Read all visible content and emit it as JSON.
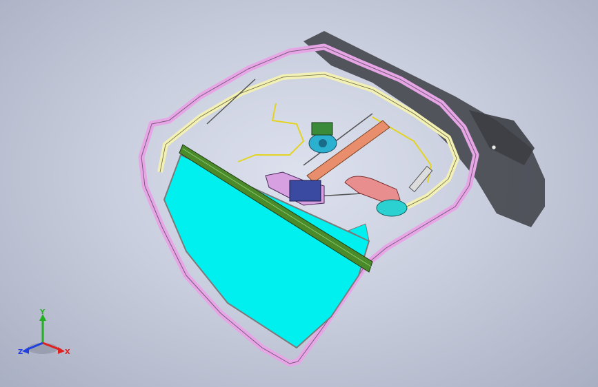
{
  "viewport": {
    "background_center": "#dde1ee",
    "background_edge": "#a9afc2"
  },
  "colors": {
    "outer_frame": "#e6a6e6",
    "inner_seal": "#f2f0b4",
    "glass": "#00f0f0",
    "glass_edge": "#7a7a7a",
    "channel": "#4a8a2a",
    "rail": "#e88e6c",
    "shadow": "#3c3e44",
    "motor": "#2bb0d0",
    "actuator": "#3a4aa0",
    "handle": "#d9a8a8",
    "cable": "#e2d420"
  },
  "triad": {
    "x_label": "X",
    "y_label": "Y",
    "z_label": "Z",
    "x_color": "#e02020",
    "y_color": "#20b020",
    "z_color": "#2040e0"
  },
  "components": [
    "door-frame",
    "window-seal",
    "door-glass",
    "glass-run-channel",
    "window-regulator-rail",
    "regulator-motor",
    "door-lock-actuator",
    "inner-door-handle",
    "wiring-harness",
    "ground-shadow"
  ]
}
